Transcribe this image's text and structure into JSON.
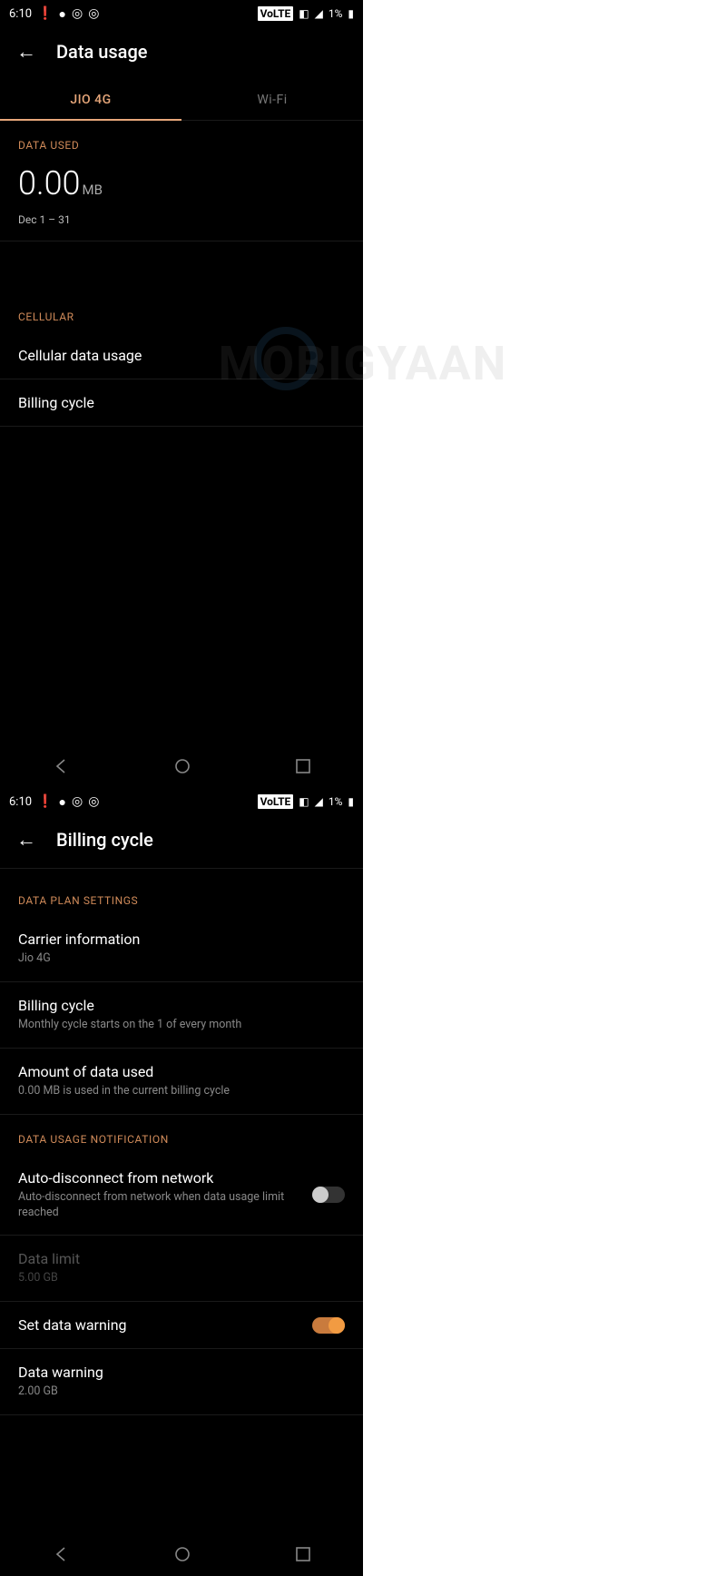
{
  "status": {
    "time": "6:10",
    "battery": "1%",
    "volte": "VoLTE"
  },
  "left_screen": {
    "title": "Data usage",
    "tabs": {
      "active": "JIO 4G",
      "inactive": "Wi-Fi"
    },
    "data_used": {
      "header": "DATA USED",
      "value": "0.00",
      "unit": "MB",
      "range": "Dec 1 – 31"
    },
    "cellular": {
      "header": "CELLULAR",
      "item1": "Cellular data usage",
      "item2": "Billing cycle"
    }
  },
  "right_screen": {
    "title": "Billing cycle",
    "plan": {
      "header": "DATA PLAN SETTINGS",
      "carrier_t": "Carrier information",
      "carrier_s": "Jio 4G",
      "billing_t": "Billing cycle",
      "billing_s": "Monthly cycle starts on the 1 of every month",
      "amount_t": "Amount of data used",
      "amount_s": " 0.00 MB is used in the current billing cycle"
    },
    "notif": {
      "header": "DATA USAGE NOTIFICATION",
      "auto_t": "Auto-disconnect from network",
      "auto_s": "Auto-disconnect from network when data usage limit reached",
      "limit_t": "Data limit",
      "limit_s": "5.00 GB",
      "warn_toggle_t": "Set data warning",
      "warn_t": "Data warning",
      "warn_s": "2.00 GB"
    }
  },
  "watermark": "MOBIGYAAN"
}
